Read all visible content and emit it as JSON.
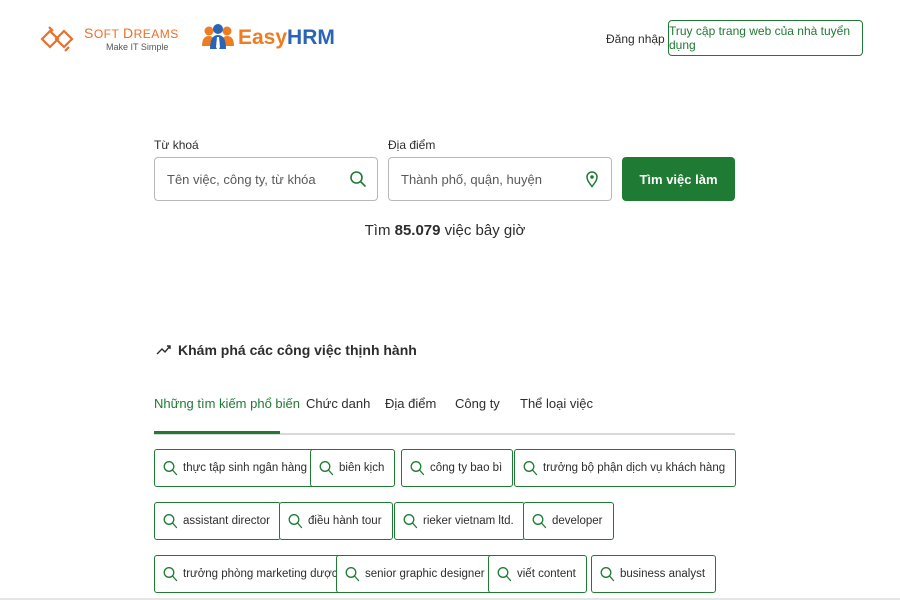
{
  "header": {
    "softdreams": {
      "brand_prefix": "S",
      "brand_rest": "OFT ",
      "brand_prefix2": "D",
      "brand_rest2": "REAMS",
      "slogan": "Make IT Simple"
    },
    "easyhrm": {
      "part1": "Easy",
      "part2": "HRM"
    },
    "login_label": "Đăng nhập",
    "employer_button_label": "Truy cập trang web của nhà tuyển dụng"
  },
  "search": {
    "keyword_label": "Từ khoá",
    "keyword_placeholder": "Tên việc, công ty, từ khóa",
    "location_label": "Địa điểm",
    "location_placeholder": "Thành phố, quận, huyện",
    "button_label": "Tìm việc làm"
  },
  "job_count": {
    "prefix": "Tìm",
    "number": "85.079",
    "suffix": "việc bây giờ"
  },
  "explore": {
    "title": "Khám phá các công việc thịnh hành",
    "tabs": [
      {
        "label": "Những tìm kiếm phổ biến"
      },
      {
        "label": "Chức danh"
      },
      {
        "label": "Địa điểm"
      },
      {
        "label": "Công ty"
      },
      {
        "label": "Thể loại việc"
      }
    ],
    "active_tab": "Những tìm kiếm phổ biến",
    "chips": [
      {
        "label": "thực tập sinh ngân hàng"
      },
      {
        "label": "biên kịch"
      },
      {
        "label": "công ty bao bì"
      },
      {
        "label": "trưởng bộ phận dịch vụ khách hàng"
      },
      {
        "label": "assistant director"
      },
      {
        "label": "điều hành tour"
      },
      {
        "label": "rieker vietnam ltd."
      },
      {
        "label": "developer"
      },
      {
        "label": "trưởng phòng marketing dược"
      },
      {
        "label": "senior graphic designer"
      },
      {
        "label": "viết content"
      },
      {
        "label": "business analyst"
      }
    ]
  },
  "colors": {
    "primary_green": "#1f7a34",
    "softdreams_orange": "#e8702a",
    "easyhrm_blue": "#2a64b4"
  }
}
